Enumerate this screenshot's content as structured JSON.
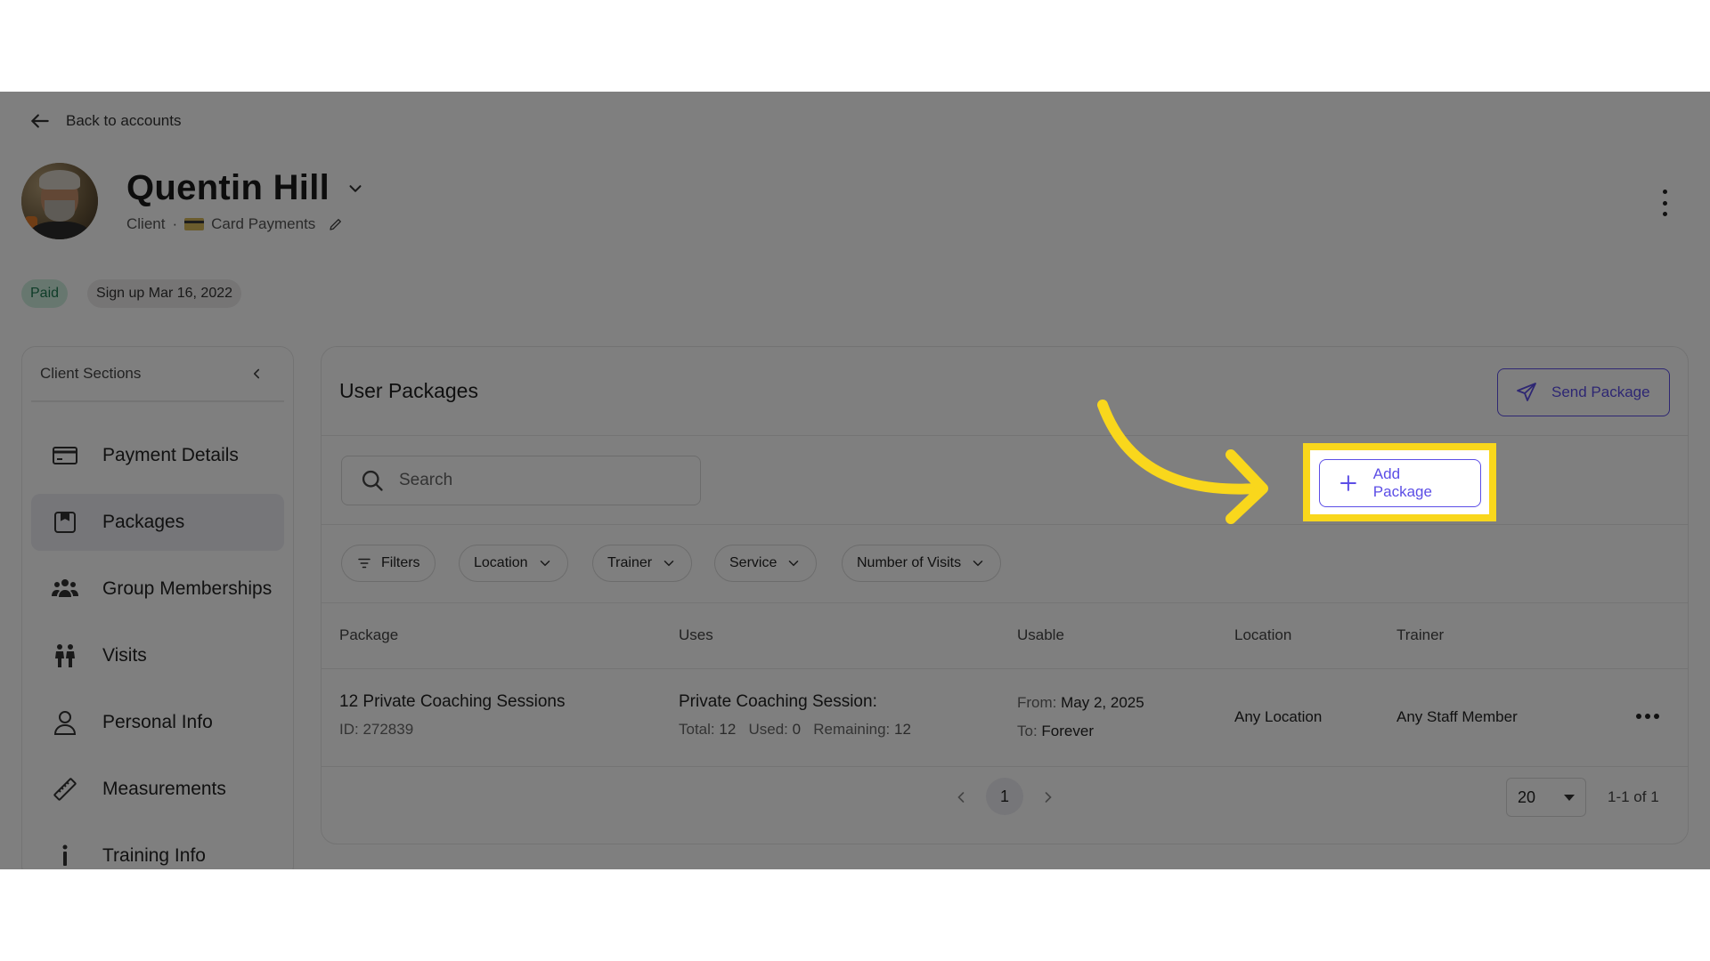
{
  "header": {
    "back_label": "Back to accounts",
    "name": "Quentin Hill",
    "role": "Client",
    "separator": "·",
    "payment_method": "Card Payments"
  },
  "badges": {
    "paid": "Paid",
    "signup": "Sign up Mar 16, 2022"
  },
  "sidebar": {
    "title": "Client Sections",
    "items": [
      {
        "label": "Payment Details",
        "icon": "credit-card-icon"
      },
      {
        "label": "Packages",
        "icon": "package-icon",
        "active": true
      },
      {
        "label": "Group Memberships",
        "icon": "group-icon"
      },
      {
        "label": "Visits",
        "icon": "visits-icon"
      },
      {
        "label": "Personal Info",
        "icon": "person-icon"
      },
      {
        "label": "Measurements",
        "icon": "ruler-icon"
      },
      {
        "label": "Training Info",
        "icon": "info-icon"
      }
    ]
  },
  "main": {
    "title": "User Packages",
    "add_button": "Add Package",
    "send_button": "Send Package",
    "search_placeholder": "Search",
    "filters": {
      "filters": "Filters",
      "location": "Location",
      "trainer": "Trainer",
      "service": "Service",
      "visits": "Number of Visits"
    },
    "columns": {
      "package": "Package",
      "uses": "Uses",
      "usable": "Usable",
      "location": "Location",
      "trainer": "Trainer"
    },
    "rows": [
      {
        "package_name": "12 Private Coaching Sessions",
        "package_id": "ID: 272839",
        "uses_title": "Private Coaching Session:",
        "total_label": "Total:",
        "total": "12",
        "used_label": "Used:",
        "used": "0",
        "remaining_label": "Remaining:",
        "remaining": "12",
        "from_label": "From:",
        "from": "May 2, 2025",
        "to_label": "To:",
        "to": "Forever",
        "location": "Any Location",
        "trainer": "Any Staff Member"
      }
    ],
    "pagination": {
      "current_page": "1",
      "per_page": "20",
      "range": "1-1 of 1"
    }
  },
  "colors": {
    "accent": "#5c4ee6",
    "highlight": "#f9d71c",
    "paid_bg": "#cfeede",
    "paid_text": "#1e7a52"
  }
}
